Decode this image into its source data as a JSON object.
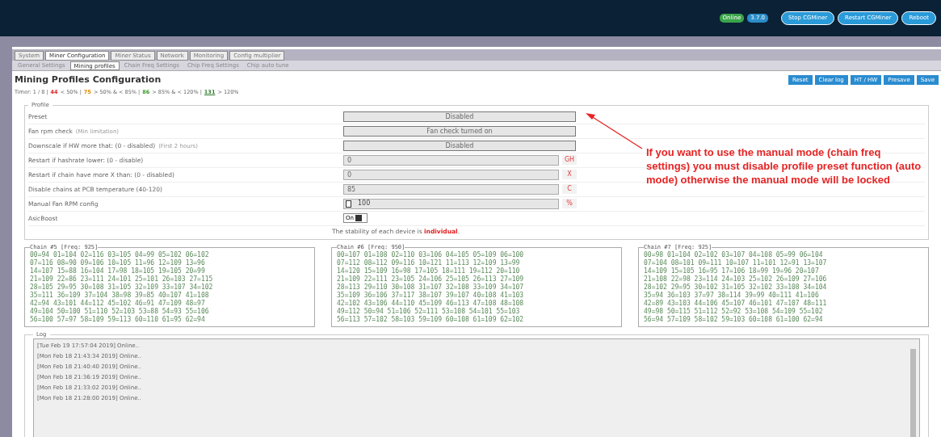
{
  "header": {
    "badges": [
      "Online",
      "3.7.0"
    ],
    "buttons": [
      "Stop CGMiner",
      "Restart CGMiner",
      "Reboot"
    ]
  },
  "tabs": [
    {
      "label": "System",
      "selected": false
    },
    {
      "label": "Miner Configuration",
      "selected": true
    },
    {
      "label": "Miner Status",
      "selected": false
    },
    {
      "label": "Network",
      "selected": false
    },
    {
      "label": "Monitoring",
      "selected": false
    },
    {
      "label": "Config multiplier",
      "selected": false
    }
  ],
  "subtabs": [
    {
      "label": "General Settings",
      "selected": false
    },
    {
      "label": "Mining profiles",
      "selected": true
    },
    {
      "label": "Chain Freq Settings",
      "selected": false
    },
    {
      "label": "Chip Freq Settings",
      "selected": false
    },
    {
      "label": "Chip auto tune",
      "selected": false
    }
  ],
  "title": "Mining Profiles Configuration",
  "actions": [
    "Reset",
    "Clear log",
    "HT / HW",
    "Presave",
    "Save"
  ],
  "timer": {
    "label": "Timer: 1 / 8 |",
    "legend": [
      {
        "value": "44",
        "text": "< 50% |",
        "color": "#dd2222"
      },
      {
        "value": "75",
        "text": "> 50% & < 85% |",
        "color": "#e08a00"
      },
      {
        "value": "86",
        "text": "> 85% & < 120% |",
        "color": "#3a9a2a"
      },
      {
        "value": "131",
        "text": "> 120%",
        "color": "#2a7a2a"
      }
    ]
  },
  "profile": {
    "legend": "Profile",
    "rows": [
      {
        "label": "Preset",
        "kind": "select",
        "value": "Disabled"
      },
      {
        "label": "Fan rpm check",
        "hint": "(Min limitation)",
        "kind": "select",
        "value": "Fan check turned on"
      },
      {
        "label": "Downscale if HW more that: (0 - disabled)",
        "hint": "(First 2 hours)",
        "kind": "select",
        "value": "Disabled"
      },
      {
        "label": "Restart if hashrate lower: (0 - disable)",
        "kind": "input",
        "value": "0",
        "unit": "GH"
      },
      {
        "label": "Restart if chain have more X than: (0 - disabled)",
        "kind": "input",
        "value": "0",
        "unit": "X"
      },
      {
        "label": "Disable chains at PCB temperature (40-120)",
        "kind": "input",
        "value": "85",
        "unit": "C"
      },
      {
        "label": "Manual Fan RPM config",
        "kind": "fan",
        "checked": false,
        "value": "100",
        "unit": "%"
      },
      {
        "label": "AsicBoost",
        "kind": "switch",
        "on": true,
        "value": "On"
      }
    ],
    "note": "The stability of each device is **individual**."
  },
  "annotation": "If you want to use the manual mode (chain freq settings) you must disable profile preset function (auto mode) otherwise the manual mode will be locked",
  "chains": [
    {
      "title": "Chain #5 [Freq: 925]",
      "rows": [
        "00=94 01=104 02=116 03=105 04=99 05=102 06=102",
        "07=116 08=90 09=106 10=105 11=96 12=109 13=96",
        "14=107 15=88 16=104 17=98 18=105 19=105 20=99",
        "21=109 22=86 23=111 24=101 25=101 26=103 27=115",
        "28=105 29=95 30=108 31=105 32=109 33=107 34=102",
        "35=111 36=109 37=104 38=98 39=85 40=107 41=108",
        "42=94 43=101 44=112 45=102 46=91 47=109 48=97",
        "49=104 50=100 51=110 52=103 53=88 54=93 55=106",
        "56=100 57=97 58=109 59=113 60=110 61=95 62=94"
      ]
    },
    {
      "title": "Chain #6 [Freq: 950]",
      "rows": [
        "00=107 01=108 02=110 03=106 04=105 05=109 06=100",
        "07=112 08=112 09=116 10=121 11=113 12=109 13=99",
        "14=120 15=109 16=98 17=105 18=111 19=112 20=110",
        "21=109 22=111 23=105 24=106 25=105 26=113 27=109",
        "28=113 29=110 30=108 31=107 32=108 33=109 34=107",
        "35=109 36=106 37=117 38=107 39=107 40=108 41=103",
        "42=102 43=106 44=110 45=109 46=113 47=108 48=108",
        "49=112 50=94 51=106 52=111 53=108 54=101 55=103",
        "56=113 57=102 58=103 59=109 60=108 61=109 62=102"
      ]
    },
    {
      "title": "Chain #7 [Freq: 925]",
      "rows": [
        "00=98 01=104 02=102 03=107 04=108 05=99 06=104",
        "07=104 08=101 09=111 10=107 11=101 12=91 13=107",
        "14=109 15=105 16=95 17=106 18=99 19=96 20=107",
        "21=108 22=98 23=114 24=103 25=102 26=109 27=106",
        "28=102 29=95 30=102 31=105 32=102 33=108 34=104",
        "35=94 36=103 37=97 38=114 39=99 40=111 41=106",
        "42=89 43=103 44=106 45=107 46=101 47=107 48=111",
        "49=98 50=115 51=112 52=92 53=108 54=109 55=102",
        "56=94 57=109 58=102 59=103 60=108 61=100 62=94"
      ]
    }
  ],
  "log": {
    "legend": "Log",
    "lines": [
      "[Tue Feb 19 17:57:04 2019] Online..",
      "[Mon Feb 18 21:43:34 2019] Online..",
      "[Mon Feb 18 21:40:40 2019] Online..",
      "[Mon Feb 18 21:36:19 2019] Online..",
      "[Mon Feb 18 21:33:02 2019] Online..",
      "[Mon Feb 18 21:28:00 2019] Online.."
    ]
  }
}
